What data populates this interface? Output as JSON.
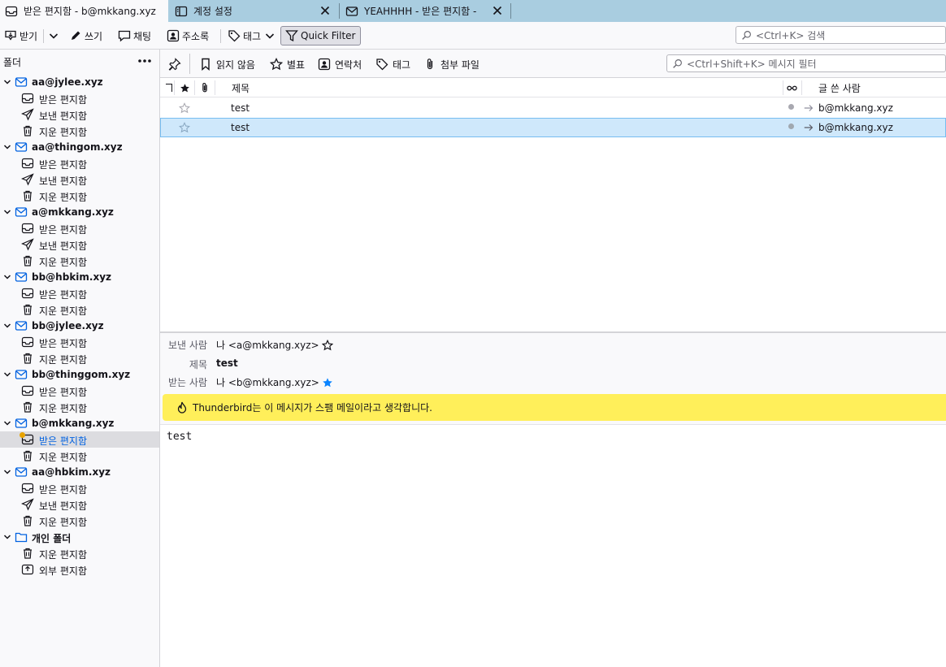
{
  "tabs": [
    {
      "label": "받은 편지함 - b@mkkang.xyz",
      "icon": "inbox-icon"
    },
    {
      "label": "계정 설정",
      "icon": "account-settings-icon"
    },
    {
      "label": "YEAHHHH - 받은 편지함 - ",
      "icon": "mail-icon"
    }
  ],
  "toolbar": {
    "get_messages": "받기",
    "write": "쓰기",
    "chat": "채팅",
    "address_book": "주소록",
    "tag": "태그",
    "quick_filter": "Quick Filter",
    "search_placeholder": "<Ctrl+K> 검색"
  },
  "folder_pane": {
    "title": "폴더",
    "accounts": [
      {
        "name": "aa@jylee.xyz",
        "folders": [
          "받은 편지함",
          "보낸 편지함",
          "지운 편지함"
        ]
      },
      {
        "name": "aa@thingom.xyz",
        "folders": [
          "받은 편지함",
          "보낸 편지함",
          "지운 편지함"
        ]
      },
      {
        "name": "a@mkkang.xyz",
        "folders": [
          "받은 편지함",
          "보낸 편지함",
          "지운 편지함"
        ]
      },
      {
        "name": "bb@hbkim.xyz",
        "folders": [
          "받은 편지함",
          "지운 편지함"
        ]
      },
      {
        "name": "bb@jylee.xyz",
        "folders": [
          "받은 편지함",
          "지운 편지함"
        ]
      },
      {
        "name": "bb@thinggom.xyz",
        "folders": [
          "받은 편지함",
          "지운 편지함"
        ]
      },
      {
        "name": "b@mkkang.xyz",
        "folders": [
          "받은 편지함",
          "지운 편지함"
        ]
      },
      {
        "name": "aa@hbkim.xyz",
        "folders": [
          "받은 편지함",
          "보낸 편지함",
          "지운 편지함"
        ]
      },
      {
        "name": "개인 폴더",
        "folders": [
          "지운 편지함",
          "외부 편지함"
        ]
      }
    ]
  },
  "quick_filter": {
    "unread": "읽지 않음",
    "starred": "별표",
    "contact": "연락처",
    "tags": "태그",
    "attachment": "첨부 파일",
    "filter_placeholder": "<Ctrl+Shift+K> 메시지 필터"
  },
  "thread_pane": {
    "columns": {
      "subject": "제목",
      "correspondent": "글 쓴 사람"
    },
    "rows": [
      {
        "subject": "test",
        "correspondent": "b@mkkang.xyz"
      },
      {
        "subject": "test",
        "correspondent": "b@mkkang.xyz"
      }
    ]
  },
  "message": {
    "from_label": "보낸 사람",
    "from_value": "나 <a@mkkang.xyz>",
    "subject_label": "제목",
    "subject_value": "test",
    "to_label": "받는 사람",
    "to_value": "나 <b@mkkang.xyz>",
    "spam_notice": "Thunderbird는 이 메시지가 스팸 메일이라고 생각합니다.",
    "body": "test"
  },
  "colors": {
    "tabbar": "#a9cde0",
    "selected_row": "#cfe8fb",
    "accent": "#0061e0",
    "spam_bar": "#ffef5a"
  }
}
